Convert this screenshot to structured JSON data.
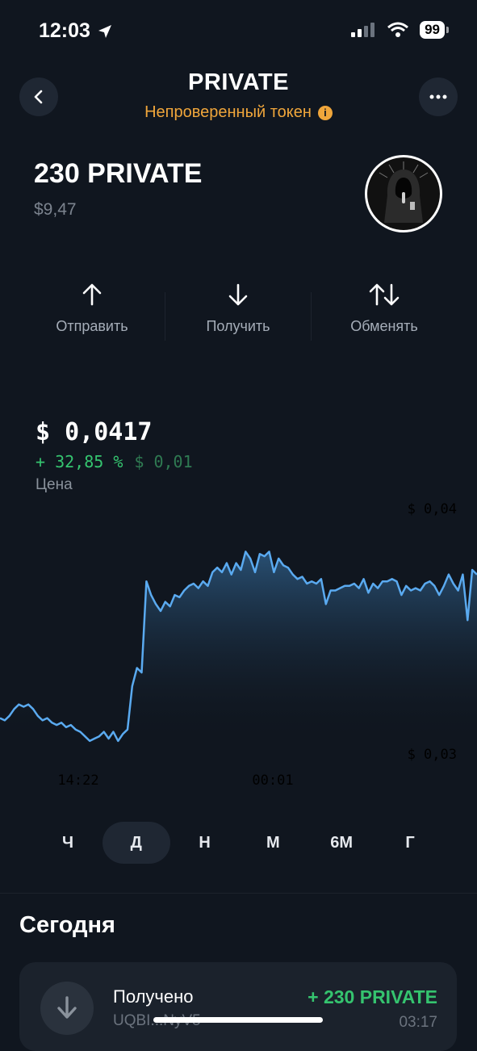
{
  "status_bar": {
    "time": "12:03",
    "battery": "99"
  },
  "header": {
    "title": "PRIVATE",
    "subtitle": "Непроверенный токен"
  },
  "balance": {
    "amount": "230 PRIVATE",
    "usd": "$9,47"
  },
  "actions": [
    {
      "label": "Отправить",
      "icon": "arrow-up-icon"
    },
    {
      "label": "Получить",
      "icon": "arrow-down-icon"
    },
    {
      "label": "Обменять",
      "icon": "swap-icon"
    }
  ],
  "price": {
    "value": "$ 0,0417",
    "change_pct": "+ 32,85 %",
    "change_abs": "$ 0,01",
    "label": "Цена"
  },
  "chart_data": {
    "type": "area",
    "y_top_label": "$ 0,04",
    "y_bottom_label": "$ 0,03",
    "x_tick_labels": [
      "14:22",
      "00:01"
    ],
    "line_color": "#5aaaf0",
    "ylim": [
      0.0276,
      0.0407
    ],
    "values": [
      0.0308,
      0.0307,
      0.0309,
      0.0312,
      0.0314,
      0.0313,
      0.0314,
      0.0312,
      0.0309,
      0.0307,
      0.0308,
      0.0306,
      0.0305,
      0.0306,
      0.0304,
      0.0305,
      0.0303,
      0.0302,
      0.03,
      0.0298,
      0.0299,
      0.03,
      0.0302,
      0.0299,
      0.0302,
      0.0298,
      0.0301,
      0.0303,
      0.0322,
      0.033,
      0.0328,
      0.0368,
      0.0362,
      0.0358,
      0.0355,
      0.0359,
      0.0357,
      0.0362,
      0.0361,
      0.0364,
      0.0366,
      0.0367,
      0.0365,
      0.0368,
      0.0366,
      0.0372,
      0.0374,
      0.0372,
      0.0376,
      0.0371,
      0.0376,
      0.0373,
      0.0381,
      0.0378,
      0.0372,
      0.038,
      0.0379,
      0.0381,
      0.0372,
      0.0378,
      0.0375,
      0.0374,
      0.0371,
      0.0369,
      0.037,
      0.0367,
      0.0368,
      0.0367,
      0.0369,
      0.0358,
      0.0364,
      0.0364,
      0.0365,
      0.0366,
      0.0366,
      0.0367,
      0.0365,
      0.0369,
      0.0363,
      0.0367,
      0.0365,
      0.0368,
      0.0368,
      0.0369,
      0.0368,
      0.0362,
      0.0366,
      0.0364,
      0.0365,
      0.0364,
      0.0367,
      0.0368,
      0.0366,
      0.0362,
      0.0366,
      0.0371,
      0.0367,
      0.0364,
      0.0371,
      0.0351,
      0.0373,
      0.0371
    ]
  },
  "periods": [
    {
      "label": "Ч",
      "active": false
    },
    {
      "label": "Д",
      "active": true
    },
    {
      "label": "Н",
      "active": false
    },
    {
      "label": "М",
      "active": false
    },
    {
      "label": "6М",
      "active": false
    },
    {
      "label": "Г",
      "active": false
    }
  ],
  "history": {
    "section_title": "Сегодня",
    "transactions": [
      {
        "title": "Получено",
        "address": "UQBI...NyV5",
        "amount": "+ 230 PRIVATE",
        "time": "03:17"
      }
    ]
  }
}
